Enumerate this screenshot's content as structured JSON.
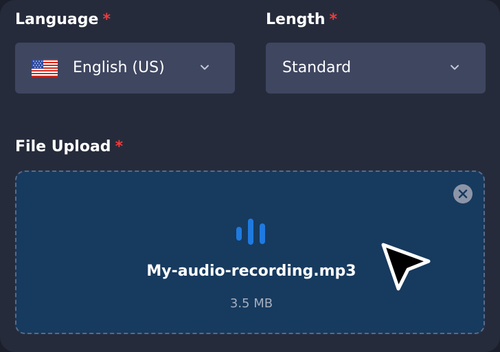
{
  "language": {
    "label": "Language",
    "required_marker": "*",
    "selected_value": "English (US)",
    "flag_icon": "us-flag-icon"
  },
  "length": {
    "label": "Length",
    "required_marker": "*",
    "selected_value": "Standard"
  },
  "file_upload": {
    "label": "File Upload",
    "required_marker": "*",
    "file_name": "My-audio-recording.mp3",
    "file_size": "3.5 MB",
    "file_icon": "audio-bars-icon",
    "remove_icon": "close-circle-icon"
  },
  "colors": {
    "panel_background": "#262b3b",
    "select_background": "#3f4660",
    "dropzone_background": "#173a5f",
    "dropzone_border": "#5d6a84",
    "accent_blue": "#1f7ae0",
    "required_red": "#ef3b3b"
  }
}
